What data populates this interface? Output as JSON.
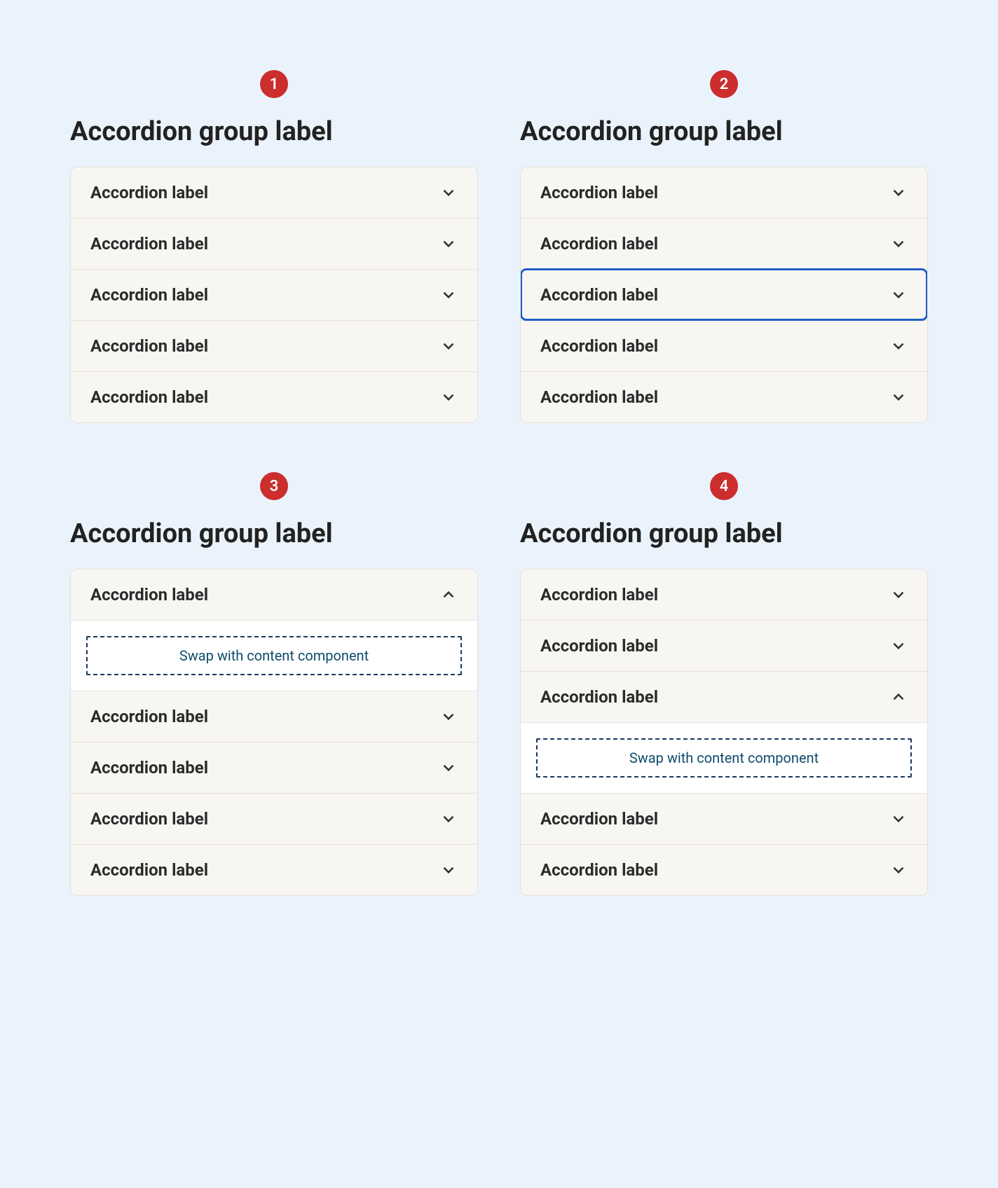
{
  "examples": [
    {
      "badge": "1",
      "group_label": "Accordion group label",
      "items": [
        {
          "label": "Accordion label",
          "expanded": false,
          "focused": false
        },
        {
          "label": "Accordion label",
          "expanded": false,
          "focused": false
        },
        {
          "label": "Accordion label",
          "expanded": false,
          "focused": false
        },
        {
          "label": "Accordion label",
          "expanded": false,
          "focused": false
        },
        {
          "label": "Accordion label",
          "expanded": false,
          "focused": false
        }
      ]
    },
    {
      "badge": "2",
      "group_label": "Accordion group label",
      "items": [
        {
          "label": "Accordion label",
          "expanded": false,
          "focused": false
        },
        {
          "label": "Accordion label",
          "expanded": false,
          "focused": false
        },
        {
          "label": "Accordion label",
          "expanded": false,
          "focused": true
        },
        {
          "label": "Accordion label",
          "expanded": false,
          "focused": false
        },
        {
          "label": "Accordion label",
          "expanded": false,
          "focused": false
        }
      ]
    },
    {
      "badge": "3",
      "group_label": "Accordion group label",
      "items": [
        {
          "label": "Accordion label",
          "expanded": true,
          "focused": false,
          "panel_text": "Swap with content component"
        },
        {
          "label": "Accordion label",
          "expanded": false,
          "focused": false
        },
        {
          "label": "Accordion label",
          "expanded": false,
          "focused": false
        },
        {
          "label": "Accordion label",
          "expanded": false,
          "focused": false
        },
        {
          "label": "Accordion label",
          "expanded": false,
          "focused": false
        }
      ]
    },
    {
      "badge": "4",
      "group_label": "Accordion group label",
      "items": [
        {
          "label": "Accordion label",
          "expanded": false,
          "focused": false
        },
        {
          "label": "Accordion label",
          "expanded": false,
          "focused": false
        },
        {
          "label": "Accordion label",
          "expanded": true,
          "focused": false,
          "panel_text": "Swap with content component"
        },
        {
          "label": "Accordion label",
          "expanded": false,
          "focused": false
        },
        {
          "label": "Accordion label",
          "expanded": false,
          "focused": false
        }
      ]
    }
  ]
}
